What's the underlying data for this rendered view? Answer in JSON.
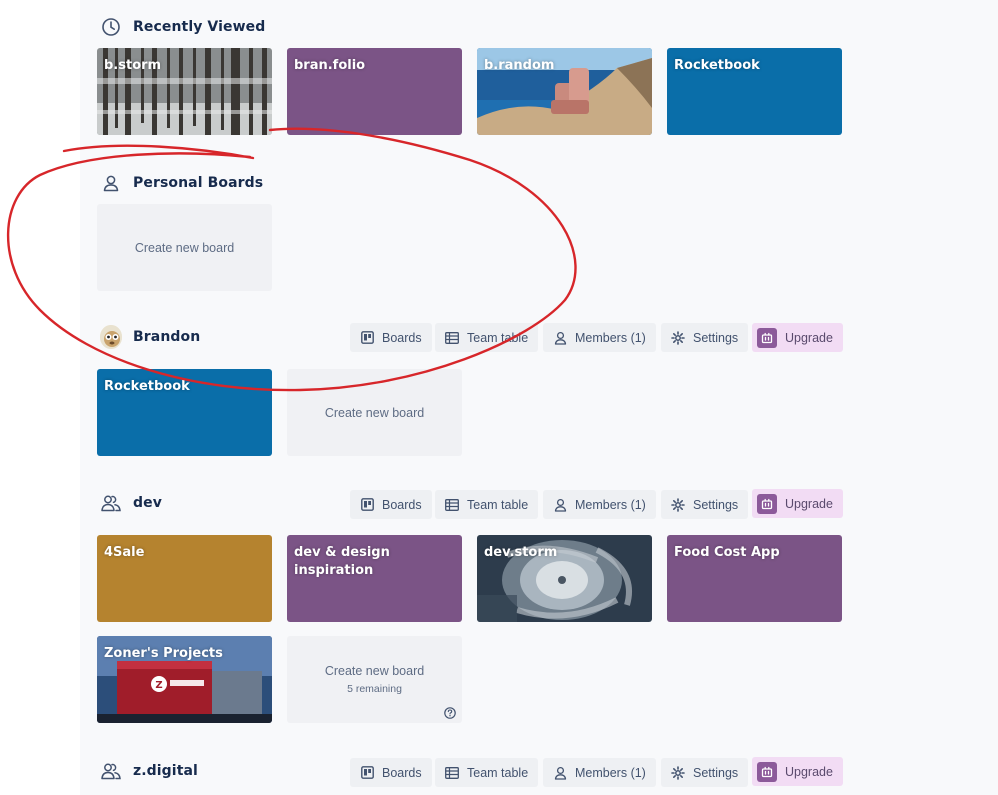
{
  "colors": {
    "purple": "#7b5486",
    "blue": "#0a6ea9",
    "orange": "#b5832f",
    "create_bg": "#f0f1f4",
    "upgrade_bg": "#f2dcf4",
    "annotation_red": "#d7262a"
  },
  "recently_viewed": {
    "title": "Recently Viewed",
    "icon": "clock-icon",
    "boards": [
      {
        "title": "b.storm",
        "bg": "snowy-forest-photo"
      },
      {
        "title": "bran.folio",
        "bg": "purple"
      },
      {
        "title": "b.random",
        "bg": "armchair-on-cliff-photo"
      },
      {
        "title": "Rocketbook",
        "bg": "blue"
      }
    ]
  },
  "personal_boards": {
    "title": "Personal Boards",
    "icon": "person-icon",
    "create_label": "Create new board"
  },
  "team_buttons": {
    "boards": "Boards",
    "team_table": "Team table",
    "members": "Members (1)",
    "settings": "Settings",
    "upgrade": "Upgrade"
  },
  "teams": [
    {
      "name": "Brandon",
      "icon": "avatar",
      "boards": [
        {
          "title": "Rocketbook",
          "bg": "blue"
        }
      ],
      "create_label": "Create new board"
    },
    {
      "name": "dev",
      "icon": "team-icon",
      "boards": [
        {
          "title": "4Sale",
          "bg": "orange"
        },
        {
          "title": "dev & design inspiration",
          "bg": "purple"
        },
        {
          "title": "dev.storm",
          "bg": "hurricane-satellite-photo"
        },
        {
          "title": "Food Cost App",
          "bg": "purple"
        },
        {
          "title": "Zoner's Projects",
          "bg": "zoners-building-photo"
        }
      ],
      "create_label": "Create new board",
      "remaining": "5 remaining"
    },
    {
      "name": "z.digital",
      "icon": "team-icon"
    }
  ]
}
